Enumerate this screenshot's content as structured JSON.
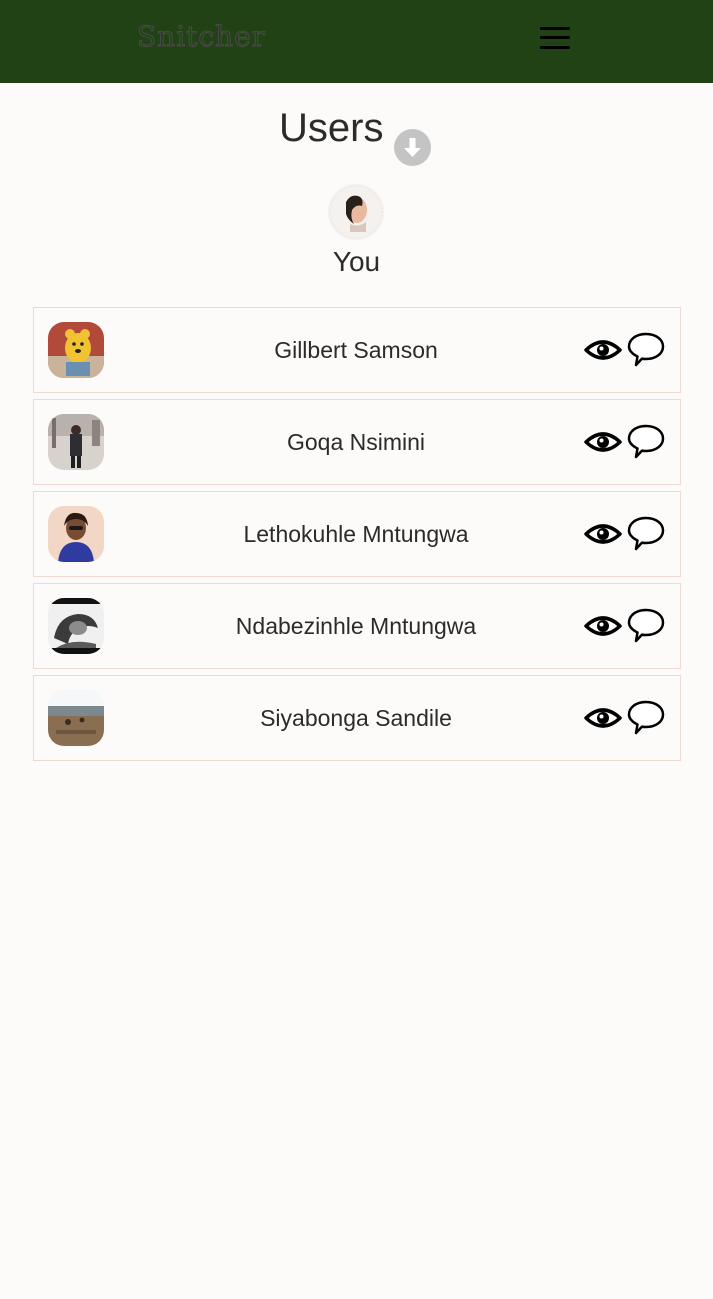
{
  "header": {
    "brand": "Snitcher",
    "menu_icon": "hamburger-menu-icon",
    "background": "#214214"
  },
  "main": {
    "title": "Users",
    "download_icon": "download-circle-icon",
    "self": {
      "label": "You"
    },
    "users": [
      {
        "name": "Gillbert Samson"
      },
      {
        "name": "Goqa Nsimini"
      },
      {
        "name": "Lethokuhle Mntungwa"
      },
      {
        "name": "Ndabezinhle Mntungwa"
      },
      {
        "name": "Siyabonga Sandile"
      }
    ],
    "row_icons": {
      "view": "eye-icon",
      "chat": "speech-bubble-icon"
    }
  }
}
